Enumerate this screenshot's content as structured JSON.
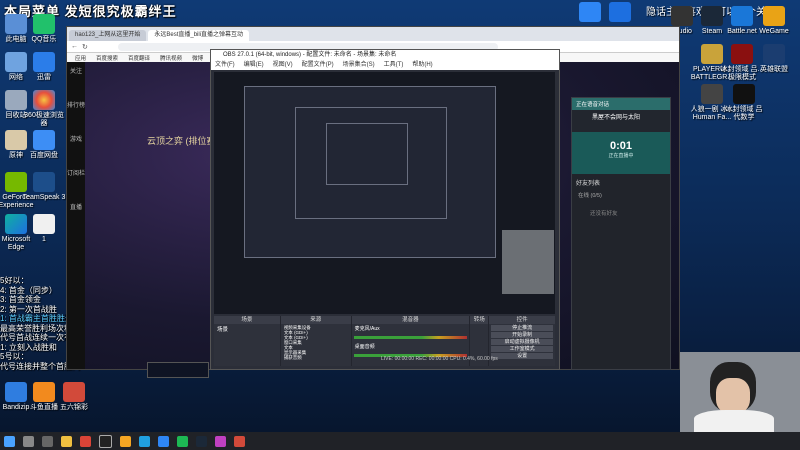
{
  "overlay": {
    "title": "本局菜单 发短很究极霸绊王",
    "right_text": "隐话主播喜欢的可以点个关注"
  },
  "desktop_icons": [
    {
      "label": "此电脑"
    },
    {
      "label": "QQ音乐"
    },
    {
      "label": "网络"
    },
    {
      "label": "迅雷"
    },
    {
      "label": "回收站"
    },
    {
      "label": "360极速浏览器"
    },
    {
      "label": "原神"
    },
    {
      "label": "百度网盘"
    },
    {
      "label": "GeForce Experience"
    },
    {
      "label": "TeamSpeak 3"
    },
    {
      "label": "Microsoft Edge"
    },
    {
      "label": "1"
    },
    {
      "label": "Bandizip"
    },
    {
      "label": "斗鱼直播"
    },
    {
      "label": "五六锦彩"
    }
  ],
  "right_icons": [
    {
      "label": "Studio"
    },
    {
      "label": "Steam"
    },
    {
      "label": "Battle.net"
    },
    {
      "label": "WeGame"
    },
    {
      "label": "PLAYERU... BATTLEGR..."
    },
    {
      "label": "冰封领域 吕... 极限模式"
    },
    {
      "label": "英雄联盟"
    },
    {
      "label": "人狼一剧 冰... Human Fa..."
    },
    {
      "label": "冰封领域 吕 代数学"
    }
  ],
  "browser": {
    "tabs": [
      "hao123_上网从这里开始",
      "永远Best直播_bili直播之弹幕互动"
    ],
    "bookmarks": [
      "应用",
      "百度搜索",
      "百度翻译",
      "腾讯视频",
      "微博"
    ],
    "sidebar": [
      "关注",
      "排行榜",
      "游戏",
      "订阅栏",
      "直播"
    ],
    "page_heading": "云顶之弈 (排位赛)"
  },
  "obs": {
    "title": "OBS 27.0.1 (64-bit, windows) - 配置文件: 未命名 - 场景集: 未命名",
    "menu": [
      "文件(F)",
      "编辑(E)",
      "视图(V)",
      "配置文件(P)",
      "场景集合(S)",
      "工具(T)",
      "帮助(H)"
    ],
    "docks": {
      "scenes": {
        "header": "场景",
        "item": "场景"
      },
      "sources": {
        "header": "来源",
        "items": [
          "视频采集设备",
          "文本 (GDI+)",
          "文本 (GDI+)",
          "窗口采集",
          "文本",
          "显示器采集",
          "捕获音频"
        ]
      },
      "mixer": {
        "header": "混音器",
        "tracks": [
          "麦克风/Aux",
          "桌面音频"
        ]
      },
      "transitions": {
        "header": "转场"
      },
      "controls": {
        "header": "控件",
        "buttons": [
          "停止推流",
          "开始录制",
          "启动虚拟摄像机",
          "工作室模式",
          "设置",
          "退出"
        ]
      }
    },
    "status": "LIVE: 00:00:00  REC: 00:00:00  CPU: 0.4%, 60.00 fps"
  },
  "kook": {
    "title": "正在语音对话",
    "channel": "黑屋不会网与太阳",
    "timer": "0:01",
    "timer_label": "正在直播中",
    "section": "好友列表",
    "group": "在线 (0/5)",
    "empty": "还没有好友"
  },
  "notifications": [
    "5好以：",
    "4: 首金（同步）",
    "3: 首金领金",
    "2: 第一次首战胜",
    "1: 首战霸主首胜胜最首战荣获首战得心",
    "最高荣誉胜利场次积分的",
    "代号首战连续一次有利",
    "1: 立刻入战胜和",
    "5号以：",
    "代号连接并整个首胜同"
  ],
  "taskbar": {
    "icons": [
      "start",
      "search",
      "task-view",
      "explorer",
      "chrome",
      "obs",
      "qq",
      "edge",
      "steam",
      "wechat",
      "kook",
      "music",
      "folder",
      "game"
    ]
  }
}
